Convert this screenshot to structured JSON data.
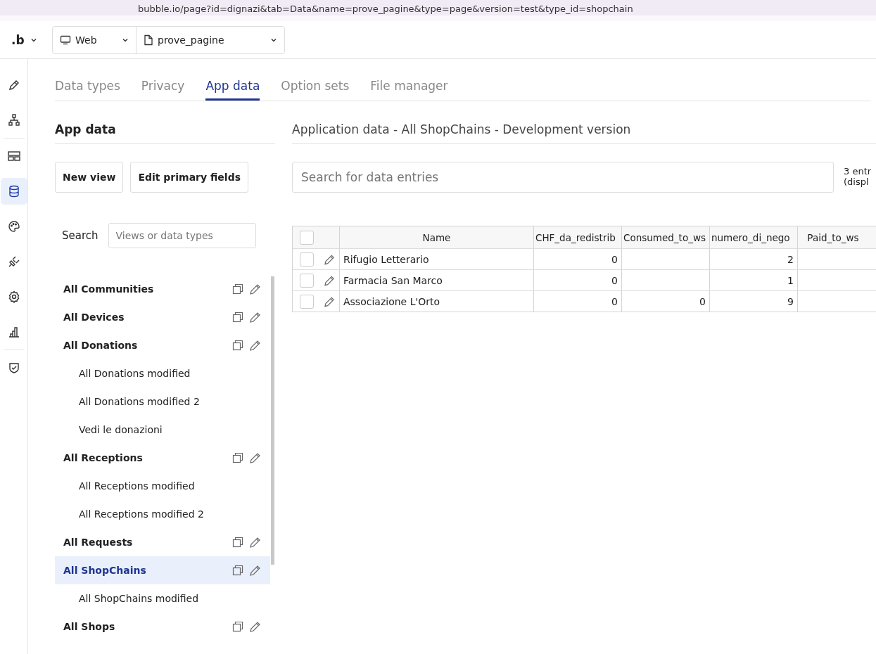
{
  "browser": {
    "url": "bubble.io/page?id=dignazi&tab=Data&name=prove_pagine&type=page&version=test&type_id=shopchain"
  },
  "topbar": {
    "logo": ".b",
    "platform": "Web",
    "page": "prove_pagine"
  },
  "rail": [
    {
      "selected": false
    },
    {
      "selected": false
    },
    {
      "selected": false
    },
    {
      "selected": true
    },
    {
      "selected": false
    },
    {
      "selected": false
    },
    {
      "selected": false
    },
    {
      "selected": false
    },
    {
      "selected": false
    }
  ],
  "tabs": [
    {
      "label": "Data types",
      "selected": false
    },
    {
      "label": "Privacy",
      "selected": false
    },
    {
      "label": "App data",
      "selected": true
    },
    {
      "label": "Option sets",
      "selected": false
    },
    {
      "label": "File manager",
      "selected": false
    }
  ],
  "left": {
    "title": "App data",
    "buttons": [
      "New view",
      "Edit primary fields"
    ],
    "search_label": "Search",
    "search": {
      "placeholder": "Views or data types"
    },
    "items": [
      {
        "label": "All Communities",
        "selected": false
      },
      {
        "label": "All Devices",
        "selected": false
      },
      {
        "label": "All Donations",
        "selected": false,
        "children": [
          {
            "label": "All Donations modified",
            "selected": false
          },
          {
            "label": "All Donations modified 2",
            "selected": false
          },
          {
            "label": "Vedi le donazioni",
            "selected": false
          }
        ]
      },
      {
        "label": "All Receptions",
        "selected": false,
        "children": [
          {
            "label": "All Receptions modified",
            "selected": false
          },
          {
            "label": "All Receptions modified 2",
            "selected": false
          }
        ]
      },
      {
        "label": "All Requests",
        "selected": false
      },
      {
        "label": "All ShopChains",
        "selected": true,
        "children": [
          {
            "label": "All ShopChains modified",
            "selected": false
          }
        ]
      },
      {
        "label": "All Shops",
        "selected": false
      }
    ]
  },
  "main": {
    "title": "Application data - All ShopChains - Development version",
    "search": {
      "placeholder": "Search for data entries"
    },
    "count": [
      "3 entr",
      "(displ"
    ],
    "table": {
      "all_checked": false,
      "columns": [
        "Name",
        "CHF_da_redistrib",
        "Consumed_to_ws",
        "numero_di_nego",
        "Paid_to_ws"
      ],
      "rows": [
        {
          "checked": false,
          "cells": [
            "Rifugio Letterario",
            "0",
            "",
            "2",
            ""
          ]
        },
        {
          "checked": false,
          "cells": [
            "Farmacia San Marco",
            "0",
            "",
            "1",
            ""
          ]
        },
        {
          "checked": false,
          "cells": [
            "Associazione L'Orto",
            "0",
            "0",
            "9",
            ""
          ]
        }
      ]
    }
  }
}
